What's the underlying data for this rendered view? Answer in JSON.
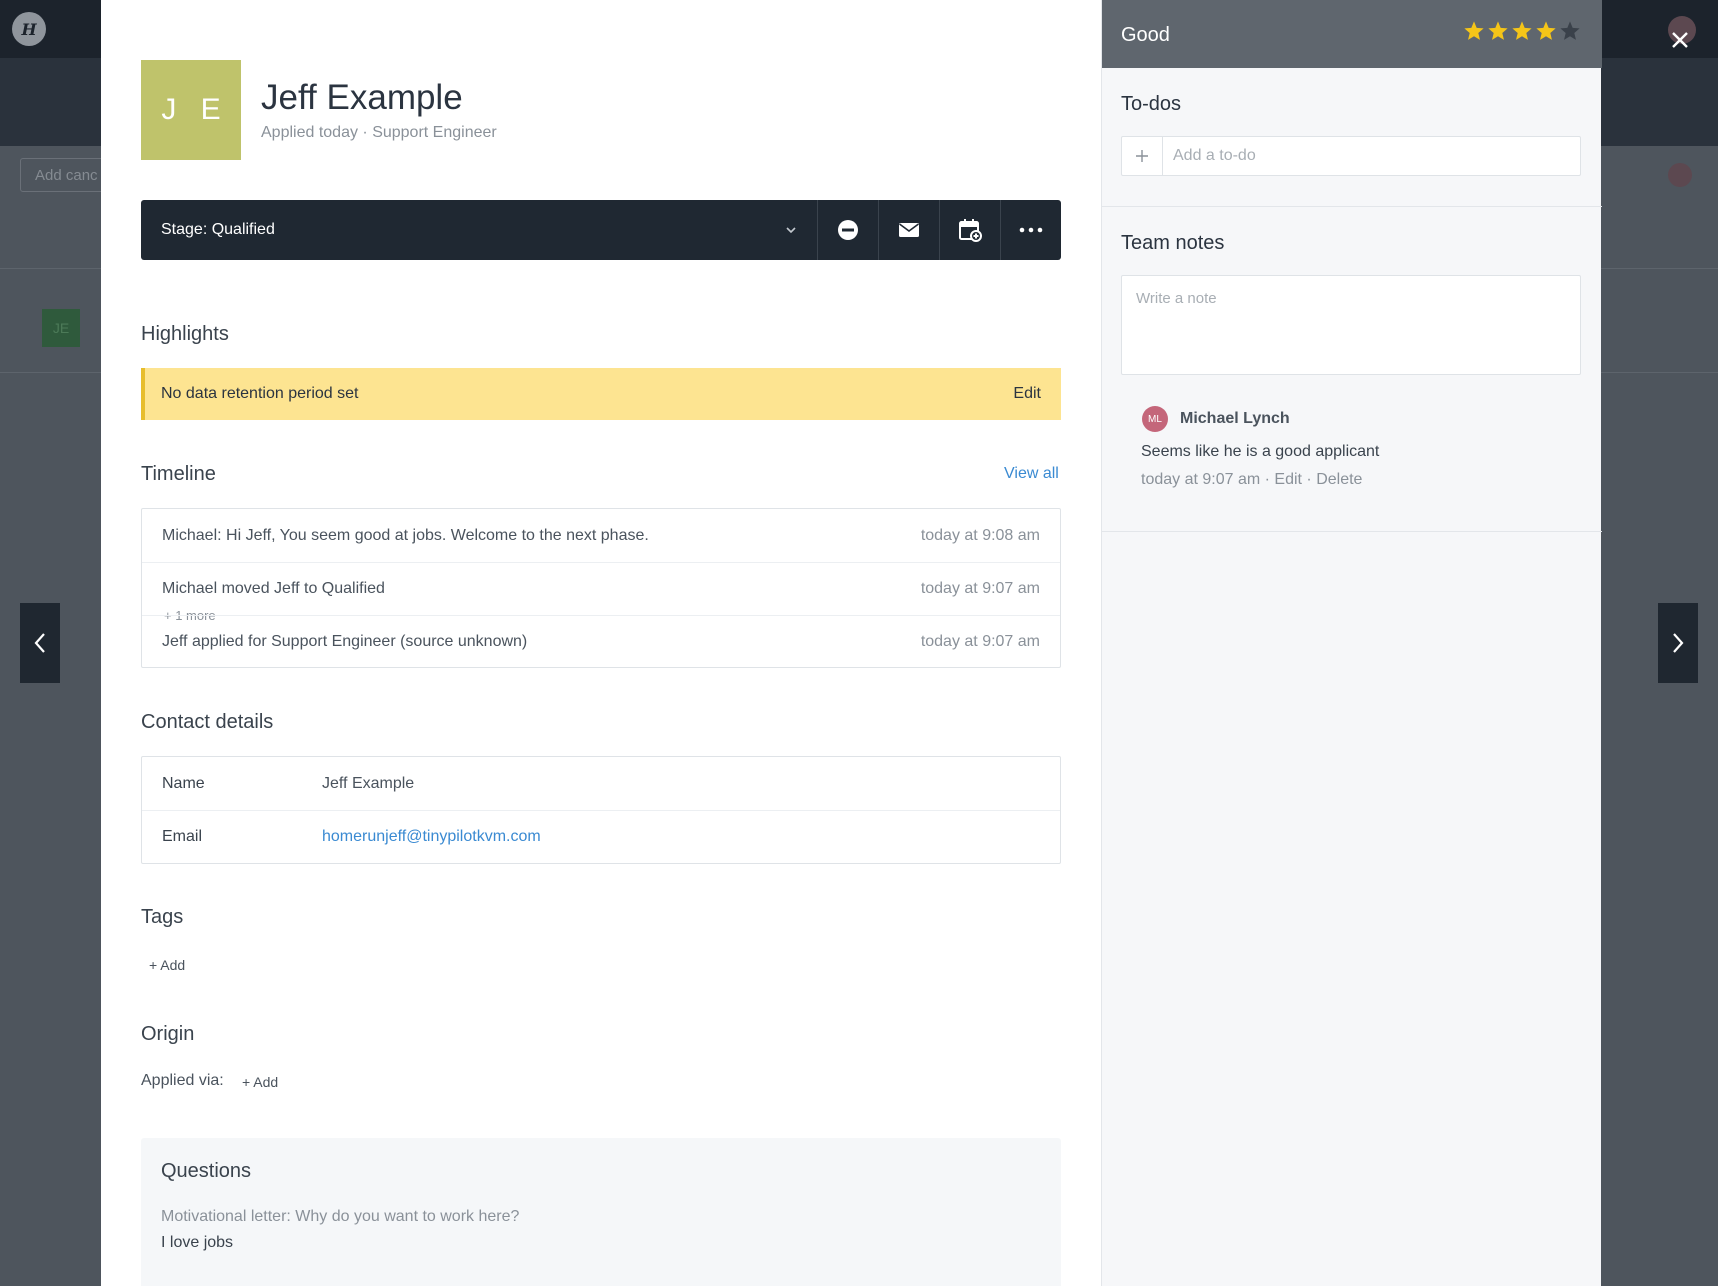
{
  "background": {
    "logo_letter": "H",
    "search_placeholder": "Add canc",
    "card_avatar": "JE"
  },
  "candidate": {
    "initials": "J E",
    "name": "Jeff Example",
    "applied": "Applied today",
    "separator": " · ",
    "position": "Support Engineer"
  },
  "stage": {
    "label": "Stage: Qualified",
    "icons": [
      "disqualify-icon",
      "email-icon",
      "schedule-icon",
      "more-icon"
    ]
  },
  "highlights": {
    "title": "Highlights",
    "message": "No data retention period set",
    "edit": "Edit"
  },
  "timeline": {
    "title": "Timeline",
    "view_all": "View all",
    "events": [
      {
        "text": "Michael: Hi Jeff, You seem good at jobs. Welcome to the next phase.",
        "time": "today at 9:08 am"
      },
      {
        "text": "Michael moved Jeff to Qualified",
        "time": "today at 9:07 am"
      },
      {
        "text": "Jeff applied for Support Engineer (source unknown)",
        "time": "today at 9:07 am"
      }
    ],
    "more": "+ 1 more"
  },
  "contact": {
    "title": "Contact details",
    "rows": [
      {
        "label": "Name",
        "value": "Jeff Example"
      },
      {
        "label": "Email",
        "value": "homerunjeff@tinypilotkvm.com"
      }
    ]
  },
  "tags": {
    "title": "Tags",
    "add": "+ Add"
  },
  "origin": {
    "title": "Origin",
    "applied_via": "Applied via:",
    "add": "+ Add"
  },
  "questions": {
    "title": "Questions",
    "items": [
      {
        "label": "Motivational letter: Why do you want to work here?",
        "answer": "I love jobs"
      }
    ]
  },
  "side": {
    "rating_label": "Good",
    "rating": 4,
    "rating_max": 5,
    "colors": {
      "star_on": "#f5c518",
      "star_off": "#3a414a"
    },
    "todos": {
      "title": "To-dos",
      "placeholder": "Add a to-do"
    },
    "notes": {
      "title": "Team notes",
      "placeholder": "Write a note",
      "items": [
        {
          "initials": "ML",
          "author": "Michael Lynch",
          "text": "Seems like he is a good applicant",
          "time": "today at 9:07 am",
          "sep": " · ",
          "edit": "Edit",
          "delete": "Delete"
        }
      ]
    }
  }
}
